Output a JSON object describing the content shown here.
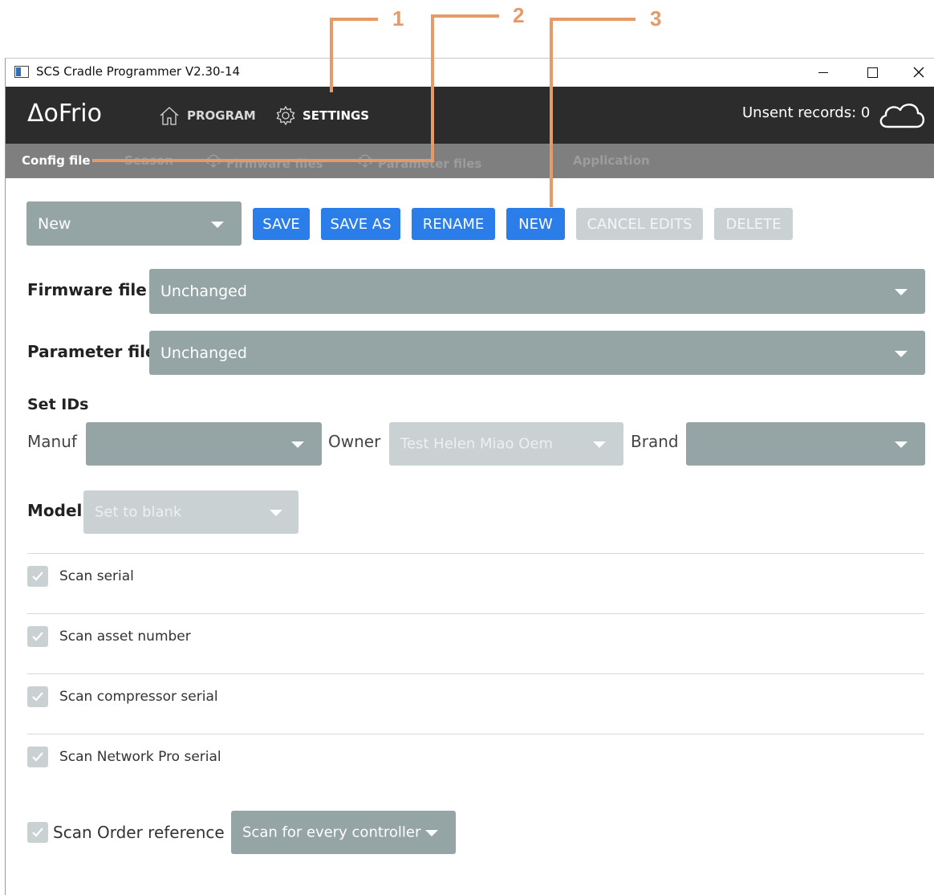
{
  "callouts": [
    "1",
    "2",
    "3"
  ],
  "window": {
    "title": "SCS Cradle Programmer V2.30-14",
    "minimize_label": "–",
    "maximize_label": "☐",
    "close_label": "✕"
  },
  "header": {
    "logo": "ΔoFrio",
    "nav": [
      {
        "label": "PROGRAM",
        "icon": "home-icon"
      },
      {
        "label": "SETTINGS",
        "icon": "gear-icon"
      }
    ],
    "unsent_records": "Unsent records: 0",
    "cloud_icon": "cloud-icon"
  },
  "subnav": {
    "items": [
      {
        "label": "Config file",
        "active": true
      },
      {
        "label": "Season",
        "active": false
      },
      {
        "label": "Firmware files",
        "active": false,
        "icon": "download-icon"
      },
      {
        "label": "Parameter files",
        "active": false,
        "icon": "download-icon"
      },
      {
        "label": "Application",
        "active": false
      }
    ]
  },
  "toolbar": {
    "config_select": "New",
    "save": "SAVE",
    "save_as": "SAVE AS",
    "rename": "RENAME",
    "new": "NEW",
    "cancel_edits": "CANCEL EDITS",
    "delete": "DELETE"
  },
  "form": {
    "firmware_label": "Firmware file",
    "firmware_value": "Unchanged",
    "parameter_label": "Parameter file",
    "parameter_value": "Unchanged",
    "set_ids_label": "Set IDs",
    "manuf_label": "Manuf",
    "manuf_value": "",
    "owner_label": "Owner",
    "owner_value": "Test Helen Miao Oem",
    "brand_label": "Brand",
    "brand_value": "",
    "model_label": "Model",
    "model_value": "Set to blank"
  },
  "checks": [
    {
      "label": "Scan serial",
      "checked": true
    },
    {
      "label": "Scan asset number",
      "checked": true
    },
    {
      "label": "Scan compressor serial",
      "checked": true
    },
    {
      "label": "Scan Network Pro serial",
      "checked": true
    }
  ],
  "order": {
    "label": "Scan Order reference",
    "checked": true,
    "select_value": "Scan for every controller"
  },
  "colors": {
    "primary_button": "#2b7de9",
    "dropdown": "#95a5a6",
    "header": "#2c2c2c",
    "callout": "#e59a67"
  }
}
